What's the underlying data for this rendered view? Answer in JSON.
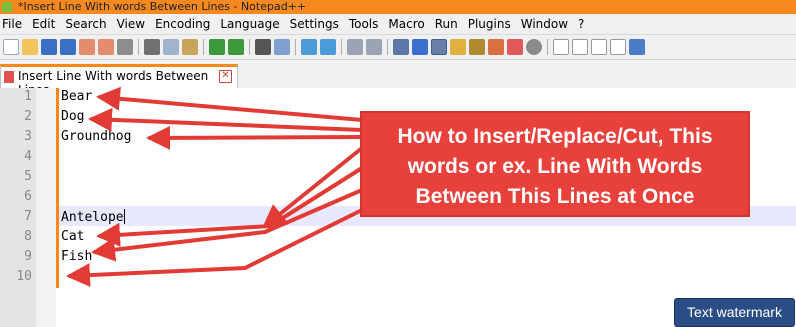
{
  "window": {
    "title": "*Insert Line With words Between Lines - Notepad++"
  },
  "menu": [
    "File",
    "Edit",
    "Search",
    "View",
    "Encoding",
    "Language",
    "Settings",
    "Tools",
    "Macro",
    "Run",
    "Plugins",
    "Window",
    "?"
  ],
  "toolbar": {
    "icons": [
      "new-file-icon",
      "open-file-icon",
      "save-icon",
      "save-all-icon",
      "close-icon",
      "close-all-icon",
      "print-icon",
      "cut-icon",
      "copy-icon",
      "paste-icon",
      "undo-icon",
      "redo-icon",
      "find-icon",
      "replace-icon",
      "zoom-in-icon",
      "zoom-out-icon",
      "sync-vertical-icon",
      "sync-horizontal-icon",
      "word-wrap-icon",
      "show-all-chars-icon",
      "indent-guide-icon",
      "lang-define-icon",
      "doc-map-icon",
      "function-list-icon",
      "folder-workspace-icon",
      "monitoring-icon",
      "record-macro-icon",
      "stop-record-icon",
      "playback-icon",
      "run-multiple-icon",
      "save-macro-icon"
    ]
  },
  "tab": {
    "label": "Insert Line With words Between Lines",
    "close_glyph": "✕"
  },
  "editor": {
    "line_numbers": [
      "1",
      "2",
      "3",
      "4",
      "5",
      "6",
      "7",
      "8",
      "9",
      "10"
    ],
    "lines": [
      "Bear",
      "Dog",
      "Groundhog",
      "",
      "",
      "",
      "Antelope",
      "Cat",
      "Fish",
      ""
    ],
    "current_line": "7"
  },
  "callout": {
    "lines": [
      "How to Insert/Replace/Cut, This",
      "words or ex. Line With Words",
      "Between This Lines at Once"
    ]
  },
  "watermark": {
    "label": "Text watermark"
  },
  "colors": {
    "title_bar": "#f5891f",
    "callout_bg": "#e8403a",
    "arrow": "#e23b36",
    "watermark_bg": "#2a4d86",
    "current_line": "#e8e8ff"
  }
}
